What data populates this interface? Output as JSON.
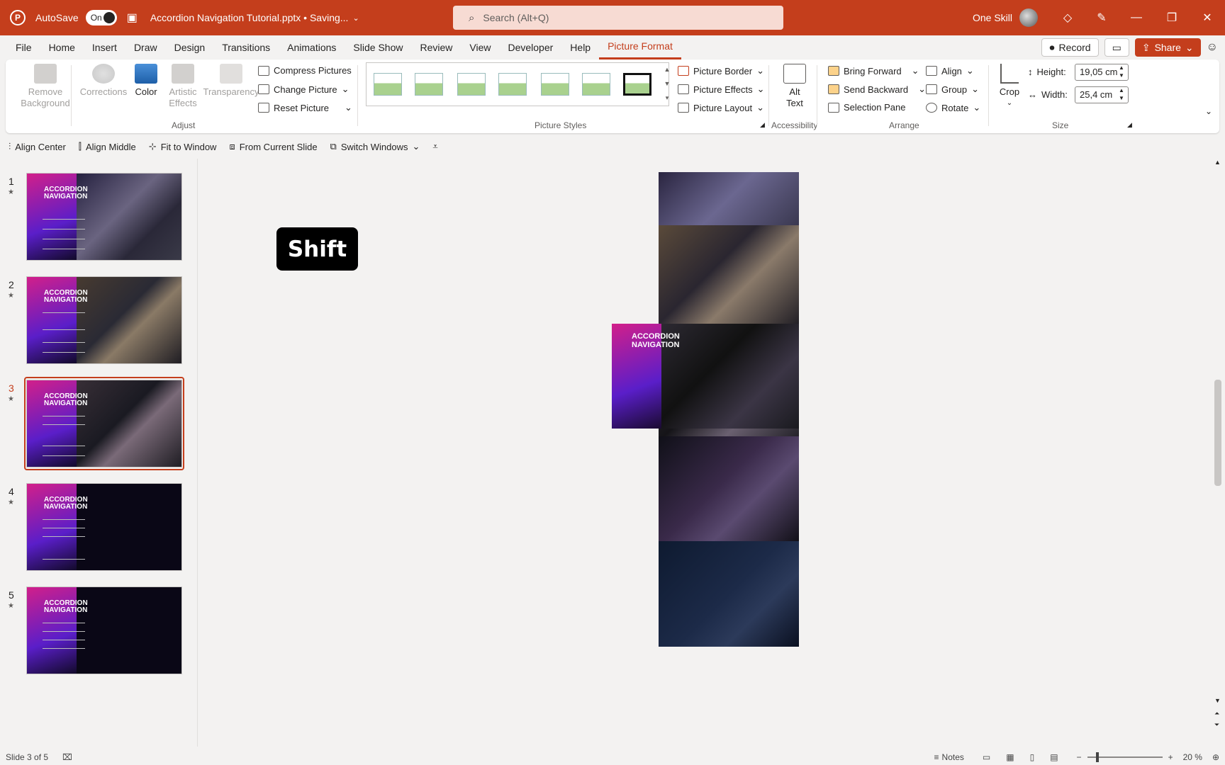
{
  "titlebar": {
    "autosave_label": "AutoSave",
    "autosave_state": "On",
    "doc_title": "Accordion Navigation Tutorial.pptx • Saving...",
    "search_placeholder": "Search (Alt+Q)",
    "user_name": "One Skill"
  },
  "tabs": [
    "File",
    "Home",
    "Insert",
    "Draw",
    "Design",
    "Transitions",
    "Animations",
    "Slide Show",
    "Review",
    "View",
    "Developer",
    "Help",
    "Picture Format"
  ],
  "tab_right": {
    "record": "Record",
    "share": "Share"
  },
  "ribbon": {
    "adjust": {
      "remove_bg": "Remove Background",
      "corrections": "Corrections",
      "color": "Color",
      "artistic": "Artistic Effects",
      "transparency": "Transparency",
      "compress": "Compress Pictures",
      "change": "Change Picture",
      "reset": "Reset Picture",
      "label": "Adjust"
    },
    "styles": {
      "label": "Picture Styles",
      "border": "Picture Border",
      "effects": "Picture Effects",
      "layout": "Picture Layout"
    },
    "accessibility": {
      "alt_text": "Alt Text",
      "label": "Accessibility"
    },
    "arrange": {
      "bring_forward": "Bring Forward",
      "send_backward": "Send Backward",
      "selection_pane": "Selection Pane",
      "align": "Align",
      "group": "Group",
      "rotate": "Rotate",
      "label": "Arrange"
    },
    "size": {
      "crop": "Crop",
      "height_label": "Height:",
      "height_value": "19,05 cm",
      "width_label": "Width:",
      "width_value": "25,4 cm",
      "label": "Size"
    }
  },
  "qat": [
    "Align Center",
    "Align Middle",
    "Fit to Window",
    "From Current Slide",
    "Switch Windows"
  ],
  "slides": [
    {
      "num": "1",
      "title": "ACCORDION NAVIGATION"
    },
    {
      "num": "2",
      "title": "ACCORDION NAVIGATION"
    },
    {
      "num": "3",
      "title": "ACCORDION NAVIGATION"
    },
    {
      "num": "4",
      "title": "ACCORDION NAVIGATION"
    },
    {
      "num": "5",
      "title": "ACCORDION NAVIGATION"
    }
  ],
  "canvas": {
    "shift_key": "Shift",
    "slide_title": "ACCORDION NAVIGATION"
  },
  "status": {
    "slide_info": "Slide 3 of 5",
    "notes": "Notes",
    "zoom": "20 %"
  },
  "colors": {
    "accent": "#c43e1c"
  }
}
